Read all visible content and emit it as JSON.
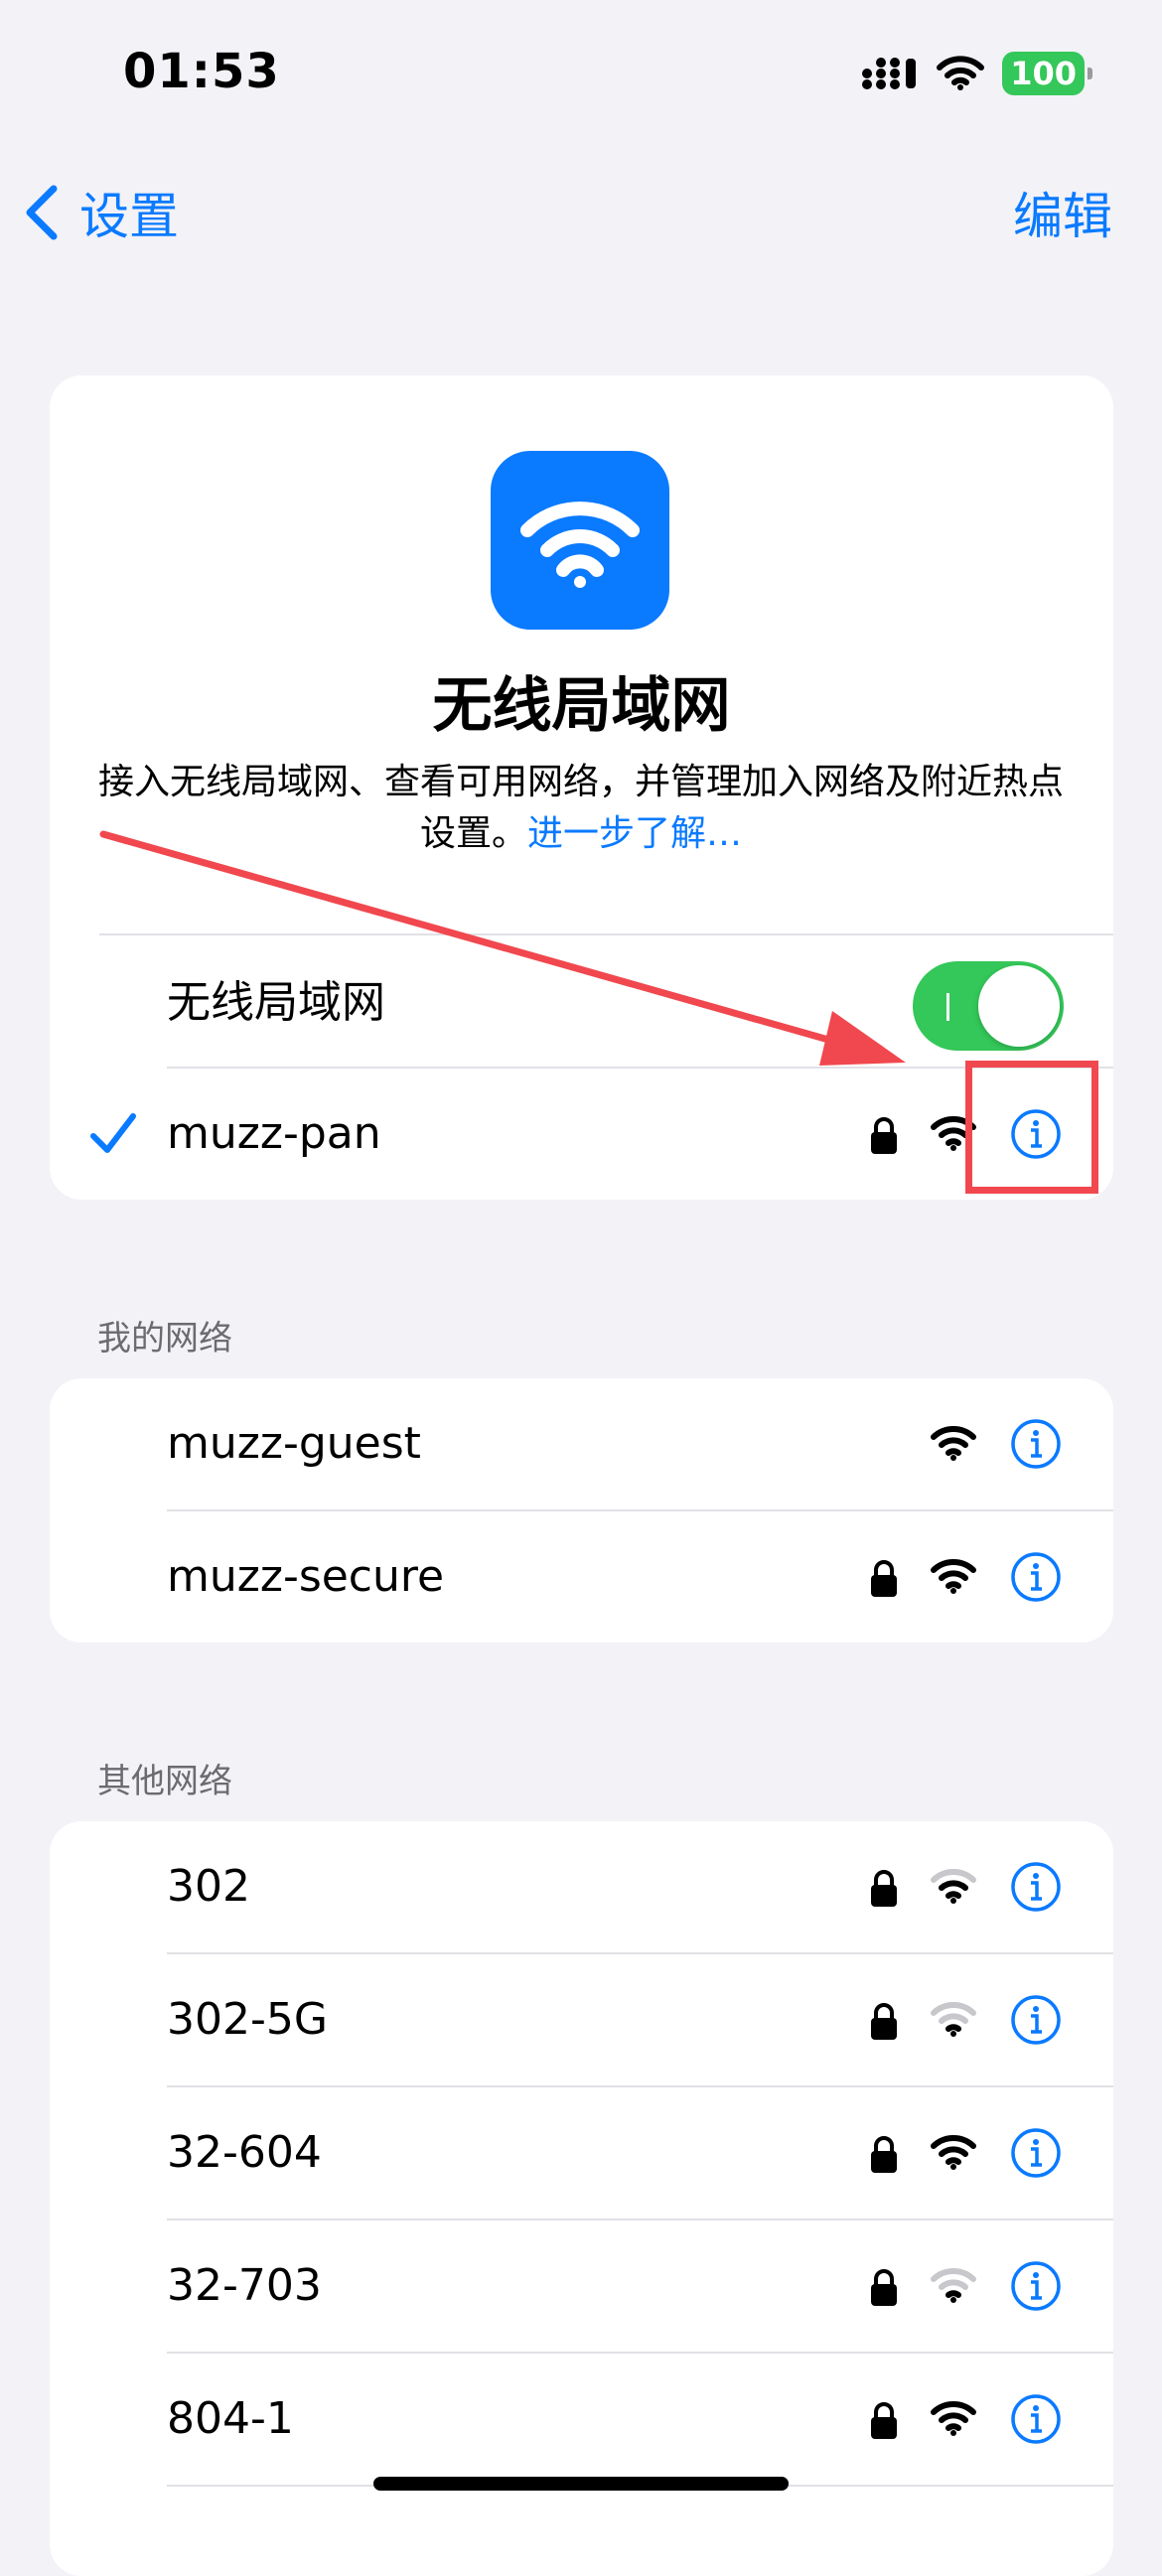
{
  "status_bar": {
    "time": "01:53",
    "battery": "100"
  },
  "nav": {
    "back_label": "设置",
    "edit_label": "编辑"
  },
  "hero": {
    "title": "无线局域网",
    "desc": "接入无线局域网、查看可用网络，并管理加入网络及附近热点设置。",
    "link": "进一步了解…"
  },
  "wifi_toggle": {
    "label": "无线局域网",
    "on": true
  },
  "current_network": {
    "name": "muzz-pan",
    "locked": true,
    "signal": "full"
  },
  "sections": {
    "my_networks_label": "我的网络",
    "other_networks_label": "其他网络"
  },
  "my_networks": [
    {
      "name": "muzz-guest",
      "locked": false,
      "signal": "full"
    },
    {
      "name": "muzz-secure",
      "locked": true,
      "signal": "full"
    }
  ],
  "other_networks": [
    {
      "name": "302",
      "locked": true,
      "signal": "weak"
    },
    {
      "name": "302-5G",
      "locked": true,
      "signal": "weak"
    },
    {
      "name": "32-604",
      "locked": true,
      "signal": "full"
    },
    {
      "name": "32-703",
      "locked": true,
      "signal": "weak"
    },
    {
      "name": "804-1",
      "locked": true,
      "signal": "full"
    }
  ],
  "colors": {
    "accent": "#0a7aff",
    "toggle_on": "#34c759",
    "annotation": "#f0484e"
  }
}
